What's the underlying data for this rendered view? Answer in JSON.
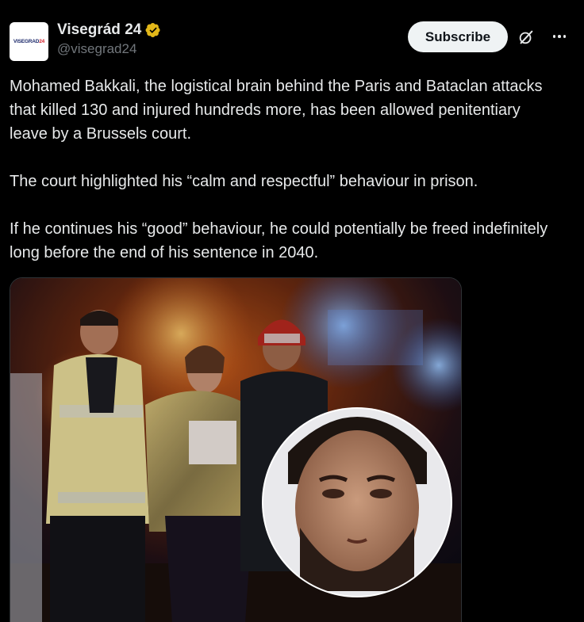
{
  "author": {
    "display_name": "Visegrád 24",
    "handle": "@visegrad24",
    "avatar_text_main": "VISEGRAD",
    "avatar_text_accent": "24",
    "verified_color": "#e2b719"
  },
  "actions": {
    "subscribe_label": "Subscribe",
    "grok_icon": "grok-icon",
    "more_icon": "more-icon"
  },
  "tweet": {
    "paragraphs": [
      "Mohamed Bakkali, the logistical brain behind the Paris and Bataclan attacks that killed 130 and injured hundreds more, has been allowed penitentiary leave by a Brussels court.",
      "The court highlighted his “calm and respectful” behaviour in prison.",
      "If he continues his “good” behaviour, he could potentially be freed indefinitely long before the end of his sentence in 2040."
    ]
  },
  "media": {
    "kind": "photo",
    "description_icon": "news-photo"
  },
  "colors": {
    "background": "#000000",
    "text": "#e7e9ea",
    "secondary_text": "#71767b",
    "button_bg": "#eff3f4"
  }
}
